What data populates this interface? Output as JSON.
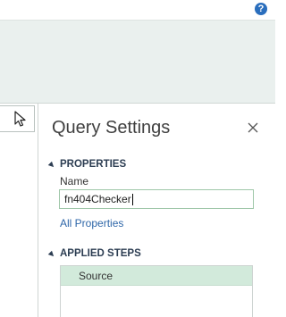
{
  "colors": {
    "ribbon_bg": "#eaf0ee",
    "accent_link": "#2e66a8",
    "selected_step_bg": "#d2eadb",
    "help_icon": "#2a6ebd"
  },
  "header": {
    "help_icon": "?"
  },
  "query_settings": {
    "title": "Query Settings",
    "close_icon": "close-icon",
    "properties": {
      "heading": "PROPERTIES",
      "name_label": "Name",
      "name_value": "fn404Checker",
      "all_properties_link": "All Properties"
    },
    "applied_steps": {
      "heading": "APPLIED STEPS",
      "steps": [
        {
          "label": "Source",
          "selected": true
        }
      ]
    }
  }
}
